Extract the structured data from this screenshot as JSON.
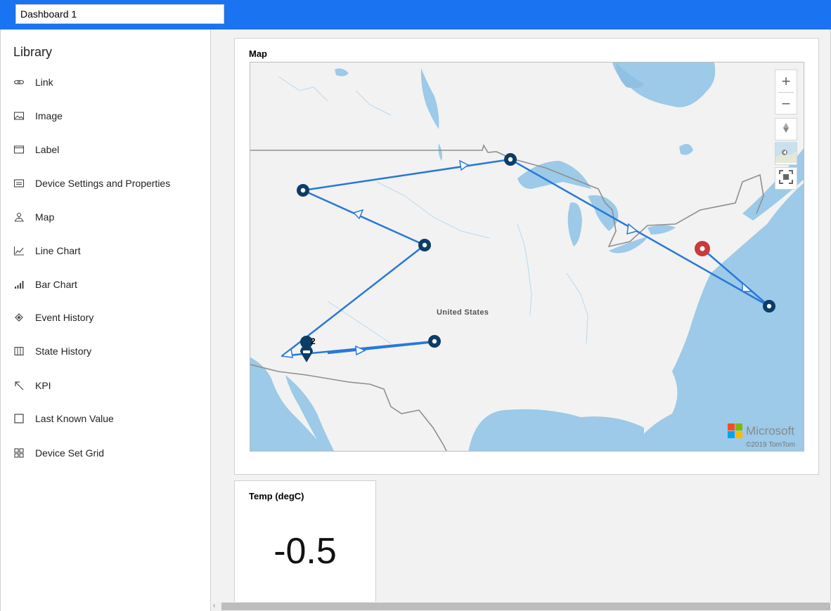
{
  "header": {
    "dashboard_name": "Dashboard 1"
  },
  "library": {
    "title": "Library",
    "items": [
      {
        "label": "Link",
        "icon": "link-icon"
      },
      {
        "label": "Image",
        "icon": "image-icon"
      },
      {
        "label": "Label",
        "icon": "label-icon"
      },
      {
        "label": "Device Settings and Properties",
        "icon": "device-settings-icon"
      },
      {
        "label": "Map",
        "icon": "map-pin-icon"
      },
      {
        "label": "Line Chart",
        "icon": "line-chart-icon"
      },
      {
        "label": "Bar Chart",
        "icon": "bar-chart-icon"
      },
      {
        "label": "Event History",
        "icon": "event-history-icon"
      },
      {
        "label": "State History",
        "icon": "state-history-icon"
      },
      {
        "label": "KPI",
        "icon": "kpi-arrow-icon"
      },
      {
        "label": "Last Known Value",
        "icon": "square-icon"
      },
      {
        "label": "Device Set Grid",
        "icon": "grid-icon"
      }
    ]
  },
  "map_tile": {
    "title": "Map",
    "region_label": "United States",
    "brand": "Microsoft",
    "copyright": "©2019 TomTom",
    "cluster_count": "2",
    "controls": {
      "zoom_in": "+",
      "zoom_out": "−"
    },
    "colors": {
      "route": "#2878d8",
      "marker": "#0b3d66",
      "current": "#c93a3a",
      "water": "#9ccae8"
    }
  },
  "kpi_tile": {
    "title": "Temp (degC)",
    "value": "-0.5"
  },
  "scrollbar": {
    "left_arrow": "‹"
  }
}
